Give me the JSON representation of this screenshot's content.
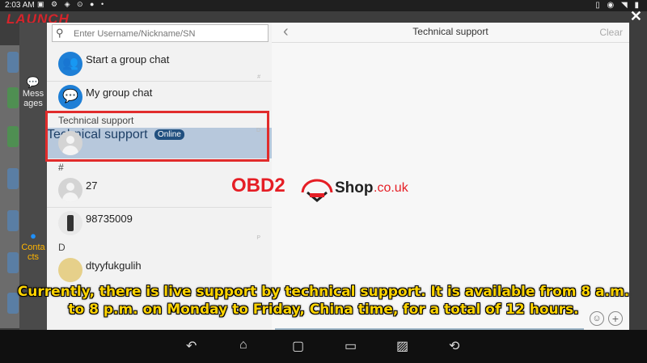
{
  "status_bar": {
    "time": "2:03 AM",
    "left_icons": [
      "photo-icon",
      "gear-icon",
      "shield-icon",
      "pin-icon",
      "mic-icon",
      "dot-icon"
    ],
    "right_icons": [
      "vibrate-icon",
      "location-icon",
      "wifi-icon",
      "battery-icon"
    ]
  },
  "brand": {
    "logo": "LAUNCH",
    "color": "#d5242b"
  },
  "left_nav": {
    "messages_label": "Mess ages",
    "contacts_label": "Conta cts",
    "active_color": "#ffb400"
  },
  "contacts": {
    "search_placeholder": "Enter Username/Nickname/SN",
    "start_group_chat": "Start a group chat",
    "my_group_chat": "My group chat",
    "section_technical": "Technical support",
    "tech_contact_name": "Technical support",
    "tech_contact_status": "Online",
    "section_hash": "#",
    "contact_27": "27",
    "contact_98735009": "98735009",
    "section_d": "D",
    "contact_dtyy": "dtyyfukgulih",
    "index_d": "D",
    "index_hash": "#",
    "index_p": "P"
  },
  "chat": {
    "title": "Technical support",
    "clear_label": "Clear"
  },
  "watermark": {
    "obd": "OBD2",
    "shop": "Shop",
    "domain": ".co.uk"
  },
  "subtitle": {
    "line1": "Currently, there is live support by technical support. It is available from 8 a.m.",
    "line2": "to 8 p.m. on Monday to Friday, China time, for a total of 12 hours."
  },
  "nav_bar": [
    "back-icon",
    "home-icon",
    "recents-icon",
    "vci-icon",
    "screenshot-icon",
    "diagnose-icon"
  ],
  "colors": {
    "highlight": "#b7c8dc",
    "accent_blue": "#1e7fd6",
    "annotation_red": "#e12c2c"
  }
}
